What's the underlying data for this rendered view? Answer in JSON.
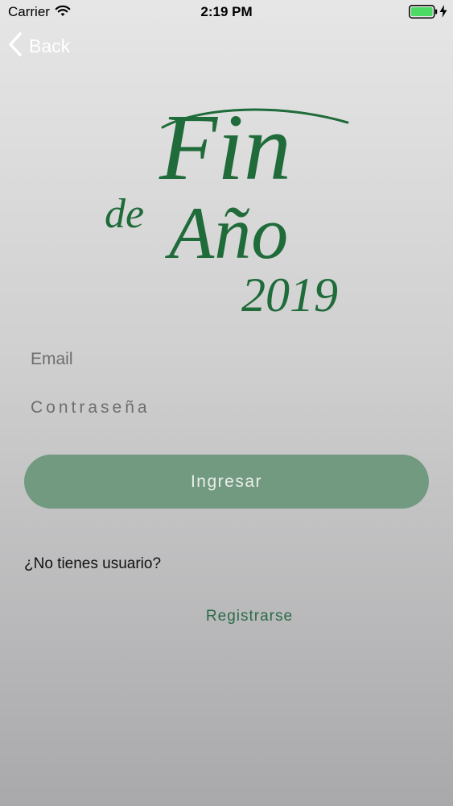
{
  "status_bar": {
    "carrier": "Carrier",
    "time": "2:19 PM",
    "wifi_icon": "wifi-icon",
    "battery_icon": "battery-icon",
    "charging_icon": "bolt-icon"
  },
  "nav": {
    "back_label": "Back",
    "back_icon": "chevron-left-icon"
  },
  "logo": {
    "line1": "Fin",
    "line2_de": "de",
    "line2_ano": "Año",
    "line3": "2019",
    "color": "#1f6b3a"
  },
  "form": {
    "email_placeholder": "Email",
    "email_value": "",
    "password_placeholder": "Contraseña",
    "password_value": "",
    "login_label": "Ingresar",
    "login_color": "#729a81"
  },
  "footer": {
    "no_user_text": "¿No tienes usuario?",
    "register_label": "Registrarse",
    "register_color": "#2b6b47"
  }
}
